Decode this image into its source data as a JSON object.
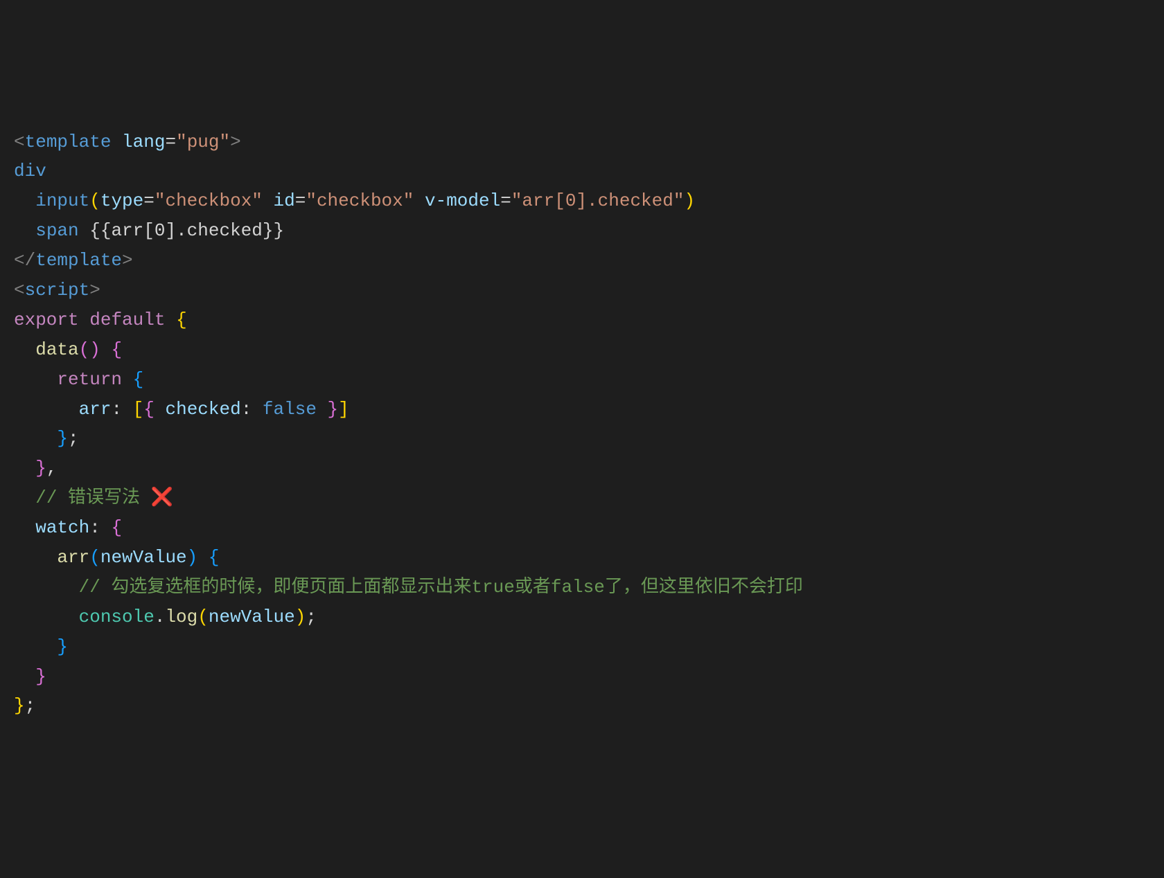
{
  "code": {
    "l1": {
      "open": "<",
      "tag": "template",
      "sp": " ",
      "attr": "lang",
      "eq": "=",
      "q1": "\"",
      "val": "pug",
      "q2": "\"",
      "close": ">"
    },
    "l2": {
      "tag": "div"
    },
    "l3": {
      "indent": "  ",
      "tag": "input",
      "lp": "(",
      "a1": "type",
      "eq1": "=",
      "v1": "\"checkbox\"",
      "sp1": " ",
      "a2": "id",
      "eq2": "=",
      "v2": "\"checkbox\"",
      "sp2": " ",
      "a3": "v-model",
      "eq3": "=",
      "v3": "\"arr[0].checked\"",
      "rp": ")"
    },
    "l4": {
      "indent": "  ",
      "tag": "span",
      "sp": " ",
      "text": "{{arr[0].checked}}"
    },
    "l5": {
      "open": "</",
      "tag": "template",
      "close": ">"
    },
    "l6": {
      "open": "<",
      "tag": "script",
      "close": ">"
    },
    "l7": {
      "kw1": "export",
      "sp1": " ",
      "kw2": "default",
      "sp2": " ",
      "brace": "{"
    },
    "l8": {
      "indent": "  ",
      "func": "data",
      "lp": "(",
      "rp": ")",
      "sp": " ",
      "brace": "{"
    },
    "l9": {
      "indent": "    ",
      "kw": "return",
      "sp": " ",
      "brace": "{"
    },
    "l10": {
      "indent": "      ",
      "prop": "arr",
      "colon": ":",
      "sp": " ",
      "lb": "[",
      "lbrace": "{",
      "sp2": " ",
      "prop2": "checked",
      "colon2": ":",
      "sp3": " ",
      "val": "false",
      "sp4": " ",
      "rbrace": "}",
      "rb": "]"
    },
    "l11": {
      "indent": "    ",
      "brace": "}",
      "semi": ";"
    },
    "l12": {
      "indent": "  ",
      "brace": "}",
      "comma": ","
    },
    "l13": {
      "indent": "  ",
      "comment": "// 错误写法 ",
      "cross": "❌"
    },
    "l14": {
      "indent": "  ",
      "prop": "watch",
      "colon": ":",
      "sp": " ",
      "brace": "{"
    },
    "l15": {
      "indent": "    ",
      "func": "arr",
      "lp": "(",
      "param": "newValue",
      "rp": ")",
      "sp": " ",
      "brace": "{"
    },
    "l16": {
      "indent": "      ",
      "comment": "// 勾选复选框的时候，即便页面上面都显示出来true或者false了，但这里依旧不会打印"
    },
    "l17": {
      "indent": "      ",
      "obj": "console",
      "dot": ".",
      "func": "log",
      "lp": "(",
      "param": "newValue",
      "rp": ")",
      "semi": ";"
    },
    "l18": {
      "indent": "    ",
      "brace": "}"
    },
    "l19": {
      "indent": "  ",
      "brace": "}"
    },
    "l20": {
      "brace": "}",
      "semi": ";"
    }
  }
}
